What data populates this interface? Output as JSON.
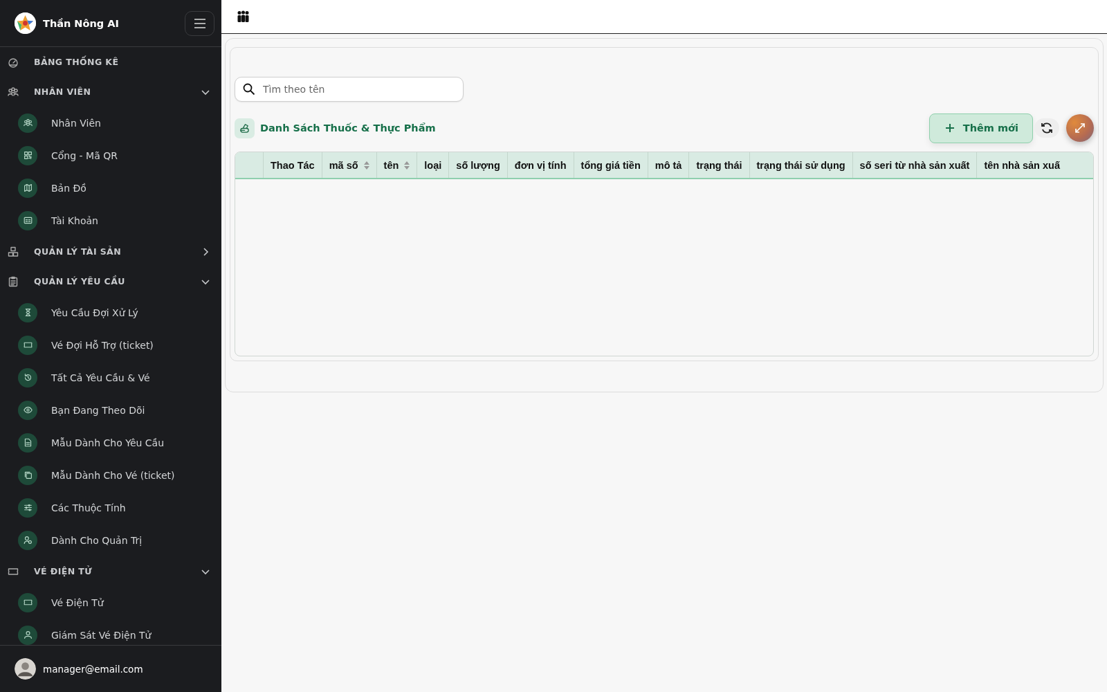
{
  "brand": {
    "name": "Thần Nông AI"
  },
  "sidebar": {
    "sections": [
      {
        "label": "BẢNG THỐNG KÊ"
      },
      {
        "label": "NHÂN VIÊN",
        "expanded": true,
        "children": [
          {
            "label": "Nhân Viên"
          },
          {
            "label": "Cổng - Mã QR"
          },
          {
            "label": "Bản Đồ"
          },
          {
            "label": "Tài Khoản"
          }
        ]
      },
      {
        "label": "QUẢN LÝ TÀI SẢN",
        "expanded": false
      },
      {
        "label": "QUẢN LÝ YÊU CẦU",
        "expanded": true,
        "children": [
          {
            "label": "Yêu Cầu Đợi Xử Lý"
          },
          {
            "label": "Vé Đợi Hỗ Trợ (ticket)"
          },
          {
            "label": "Tất Cả Yêu Cầu & Vé"
          },
          {
            "label": "Bạn Đang Theo Dõi"
          },
          {
            "label": "Mẫu Dành Cho Yêu Cầu"
          },
          {
            "label": "Mẫu Dành Cho Vé (ticket)"
          },
          {
            "label": "Các Thuộc Tính"
          },
          {
            "label": "Dành Cho Quản Trị"
          }
        ]
      },
      {
        "label": "VÉ ĐIỆN TỬ",
        "expanded": true,
        "children": [
          {
            "label": "Vé Điện Tử"
          },
          {
            "label": "Giám Sát Vé Điện Tử"
          }
        ]
      }
    ]
  },
  "user": {
    "email": "manager@email.com"
  },
  "search": {
    "placeholder": "Tìm theo tên"
  },
  "list": {
    "title": "Danh Sách Thuốc & Thực Phẩm",
    "add_button": "Thêm mới"
  },
  "table": {
    "columns": [
      {
        "label": "Thao Tác",
        "sortable": false
      },
      {
        "label": "mã số",
        "sortable": true
      },
      {
        "label": "tên",
        "sortable": true
      },
      {
        "label": "loại",
        "sortable": false
      },
      {
        "label": "số lượng",
        "sortable": false
      },
      {
        "label": "đơn vị tính",
        "sortable": false
      },
      {
        "label": "tổng giá tiền",
        "sortable": false
      },
      {
        "label": "mô tả",
        "sortable": false
      },
      {
        "label": "trạng thái",
        "sortable": false
      },
      {
        "label": "trạng thái sử dụng",
        "sortable": false
      },
      {
        "label": "số seri từ nhà sản xuất",
        "sortable": false
      },
      {
        "label": "tên nhà sản xuấ",
        "sortable": false
      }
    ]
  }
}
